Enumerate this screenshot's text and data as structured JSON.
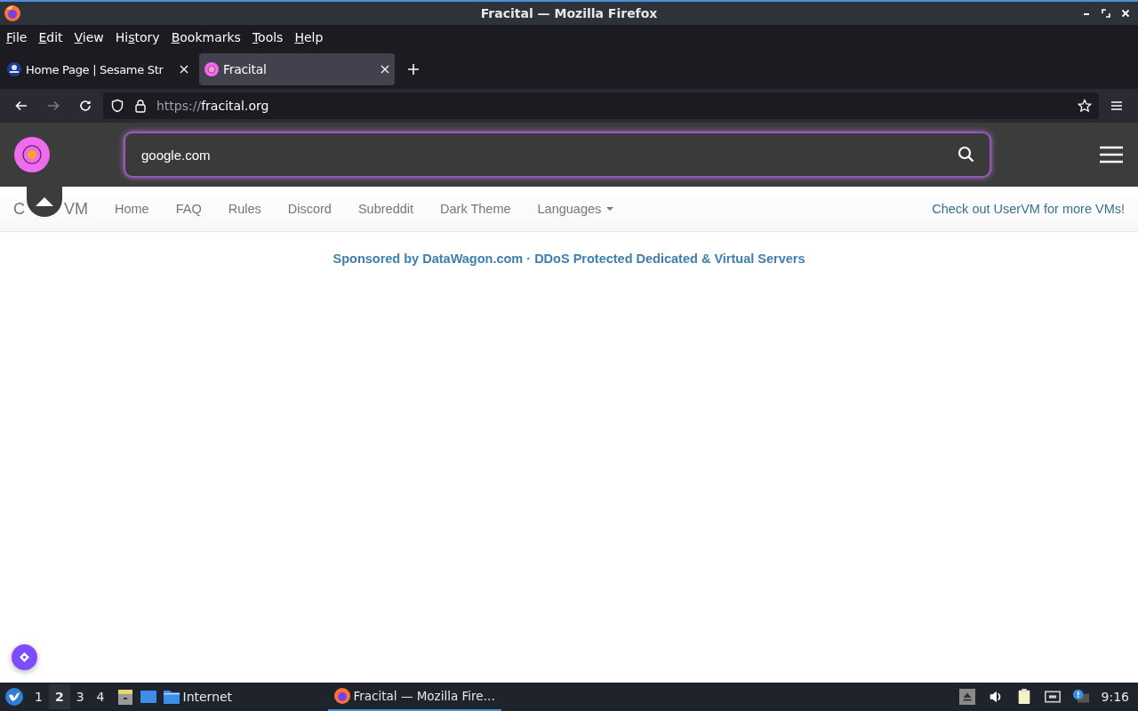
{
  "window": {
    "title": "Fracital — Mozilla Firefox"
  },
  "menu": [
    {
      "key": "F",
      "rest": "ile"
    },
    {
      "key": "E",
      "rest": "dit"
    },
    {
      "key": "V",
      "rest": "iew"
    },
    {
      "lead": "Hi",
      "key": "s",
      "rest": "tory"
    },
    {
      "key": "B",
      "rest": "ookmarks"
    },
    {
      "key": "T",
      "rest": "ools"
    },
    {
      "key": "H",
      "rest": "elp"
    }
  ],
  "tabs": [
    {
      "label": "Home Page | Sesame Str",
      "selected": false,
      "kind": "pbs"
    },
    {
      "label": "Fracital",
      "selected": true,
      "kind": "fracital"
    }
  ],
  "address": {
    "scheme": "https://",
    "host": "fracital.org"
  },
  "site": {
    "search_value": "google.com",
    "brand": [
      "C",
      "VM"
    ],
    "nav": [
      "Home",
      "FAQ",
      "Rules",
      "Discord",
      "Subreddit",
      "Dark Theme"
    ],
    "languages": "Languages",
    "right_link": "Check out UserVM for more VMs!",
    "sponsor": "Sponsored by DataWagon.com · DDoS Protected Dedicated & Virtual Servers"
  },
  "taskbar": {
    "workspaces": [
      {
        "label": "1",
        "selected": false
      },
      {
        "label": "2",
        "selected": true
      },
      {
        "label": "3",
        "selected": false
      },
      {
        "label": "4",
        "selected": false
      }
    ],
    "launcher": "Internet",
    "task": "Fracital — Mozilla Fire…",
    "clock": "9:16"
  }
}
